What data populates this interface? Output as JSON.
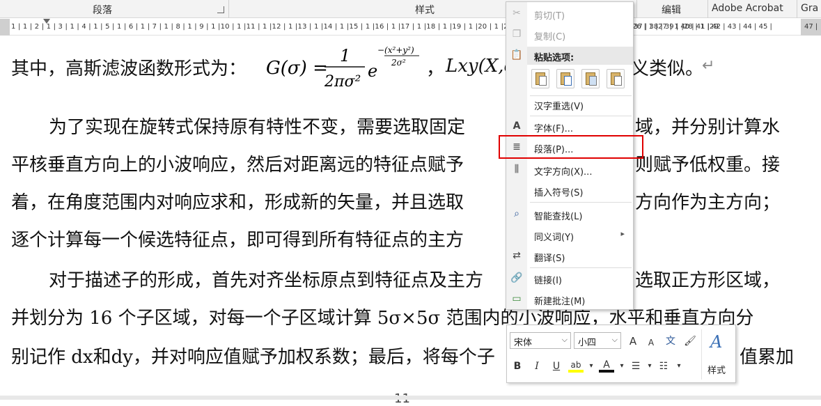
{
  "ribbon": {
    "groups": [
      "段落",
      "样式",
      "编辑",
      "Adobe Acrobat",
      "Gra"
    ]
  },
  "ruler": {
    "left_numbers": "1 | 1 | 2 | 1 | 3 | 1 | 4 | 1 | 5 | 1 | 6 | 1 | 7 | 1 | 8 | 1 | 9 | 1 |10 | 1 |11 | 1 |12 | 1 |13 | 1 |14 | 1 |15 | 1 |16 | 1 |17 | 1 |18 | 1 |19 | 1 |20 | 1 |21 | 1 |22 | 1 |23 | 1 |24 | 1 |25 | 1 |26 | 1 |27 | 1 |28 | 1 |29",
    "right_numbers": "37 | 38 | 39 | 40 | 41 | 42 | 43 | 44 | 45 |",
    "far_right": "47 |"
  },
  "document": {
    "line1_text": "其中，高斯滤波函数形式为：",
    "line1_formula": "G(σ) = 1/(2πσ²) e^(−(x²+y²)/(2σ²))",
    "line1_comma": "，",
    "line1_tail_formula": "Lxy(X,σ",
    "line1_end": "义类似。",
    "para2": [
      "为了实现在旋转式保持原有特性不变，需要选取固定",
      "域，并分别计算水",
      "平核垂直方向上的小波响应，然后对距离远的特征点赋予",
      "则赋予低权重。接",
      "着，在角度范围内对响应求和，形成新的矢量，并且选取",
      "方向作为主方向；",
      "逐个计算每一个候选特征点，即可得到所有特征点的主方"
    ],
    "para3": [
      "对于描述子的形成，首先对齐坐标原点到特征点及主方",
      "选取正方形区域，",
      "并划分为 16 个子区域，对每一个子区域计算 5σ×5σ 范围内的小波响应，水平和垂直方向分",
      "别记作 dx和dy，并对响应值赋予加权系数；最后，将每个子",
      "值累加"
    ],
    "page_number": "11"
  },
  "context_menu": {
    "items": [
      {
        "label": "剪切(T)",
        "icon": "scissors-icon",
        "disabled": true
      },
      {
        "label": "复制(C)",
        "icon": "copy-icon",
        "disabled": true
      },
      {
        "label": "粘贴选项:",
        "icon": "clipboard-icon",
        "disabled": false
      },
      {
        "label": "汉字重选(V)",
        "icon": "",
        "disabled": false
      },
      {
        "label": "字体(F)...",
        "icon": "font-icon",
        "disabled": false
      },
      {
        "label": "段落(P)...",
        "icon": "paragraph-icon",
        "disabled": false
      },
      {
        "label": "文字方向(X)...",
        "icon": "text-direction-icon",
        "disabled": false
      },
      {
        "label": "插入符号(S)",
        "icon": "",
        "disabled": false
      },
      {
        "label": "智能查找(L)",
        "icon": "smart-lookup-icon",
        "disabled": false
      },
      {
        "label": "同义词(Y)",
        "icon": "",
        "disabled": false
      },
      {
        "label": "翻译(S)",
        "icon": "translate-icon",
        "disabled": false
      },
      {
        "label": "链接(I)",
        "icon": "link-icon",
        "disabled": false
      },
      {
        "label": "新建批注(M)",
        "icon": "comment-icon",
        "disabled": false
      }
    ],
    "submenu_arrow": "▸"
  },
  "mini_toolbar": {
    "font_name": "宋体",
    "font_size": "小四",
    "style_label": "样式",
    "grow_font": "A",
    "shrink_font": "A",
    "phonetic": "文",
    "bold": "B",
    "italic": "I",
    "underline": "U",
    "highlight": "ab",
    "font_color": "A"
  },
  "colors": {
    "highlight_box": "#e00000",
    "link_blue": "#3a6fb5"
  }
}
